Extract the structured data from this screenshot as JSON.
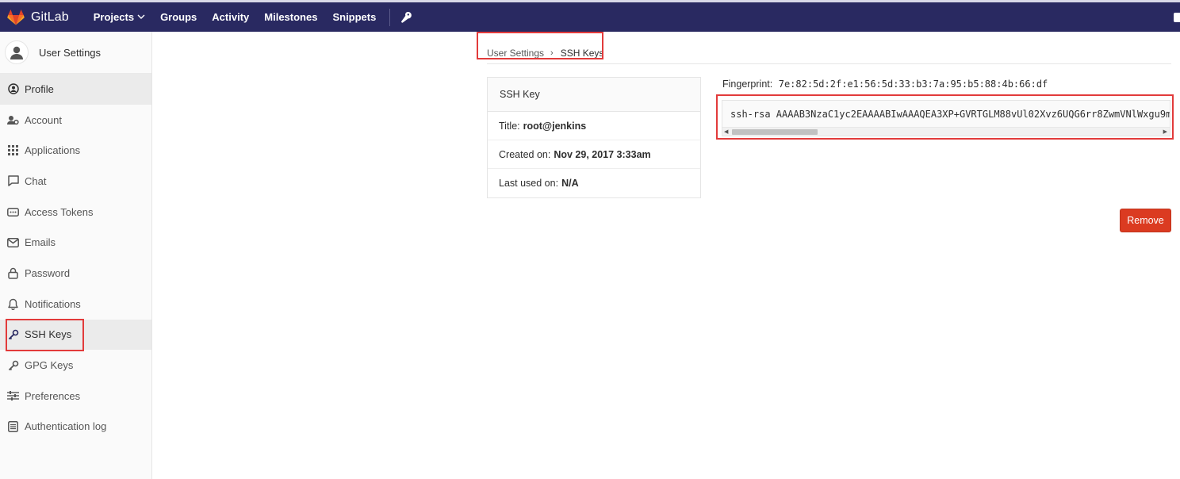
{
  "app": {
    "brand": "GitLab",
    "colors": {
      "nav_bg": "#292961",
      "danger": "#db3b21",
      "highlight": "#e23b3b",
      "logo": "#e24329"
    }
  },
  "topnav": {
    "items": [
      {
        "label": "Projects",
        "has_dropdown": true
      },
      {
        "label": "Groups"
      },
      {
        "label": "Activity"
      },
      {
        "label": "Milestones"
      },
      {
        "label": "Snippets"
      }
    ],
    "admin_icon": "wrench-icon"
  },
  "sidebar": {
    "title": "User Settings",
    "items": [
      {
        "label": "Profile",
        "icon": "profile-icon"
      },
      {
        "label": "Account",
        "icon": "account-icon"
      },
      {
        "label": "Applications",
        "icon": "applications-icon"
      },
      {
        "label": "Chat",
        "icon": "chat-icon"
      },
      {
        "label": "Access Tokens",
        "icon": "token-icon"
      },
      {
        "label": "Emails",
        "icon": "email-icon"
      },
      {
        "label": "Password",
        "icon": "lock-icon"
      },
      {
        "label": "Notifications",
        "icon": "bell-icon"
      },
      {
        "label": "SSH Keys",
        "icon": "key-icon",
        "active": true
      },
      {
        "label": "GPG Keys",
        "icon": "key-icon"
      },
      {
        "label": "Preferences",
        "icon": "sliders-icon"
      },
      {
        "label": "Authentication log",
        "icon": "log-icon"
      }
    ]
  },
  "breadcrumb": {
    "parent": "User Settings",
    "separator": "›",
    "current": "SSH Keys"
  },
  "key": {
    "header": "SSH Key",
    "title_label": "Title:",
    "title": "root@jenkins",
    "created_label": "Created on:",
    "created": "Nov 29, 2017 3:33am",
    "last_used_label": "Last used on:",
    "last_used": "N/A",
    "fingerprint_label": "Fingerprint:",
    "fingerprint": "7e:82:5d:2f:e1:56:5d:33:b3:7a:95:b5:88:4b:66:df",
    "public_key": "ssh-rsa AAAAB3NzaC1yc2EAAAABIwAAAQEA3XP+GVRTGLM88vUl02Xvz6UQG6rr8ZwmVNlWxgu9m"
  },
  "actions": {
    "remove": "Remove"
  }
}
